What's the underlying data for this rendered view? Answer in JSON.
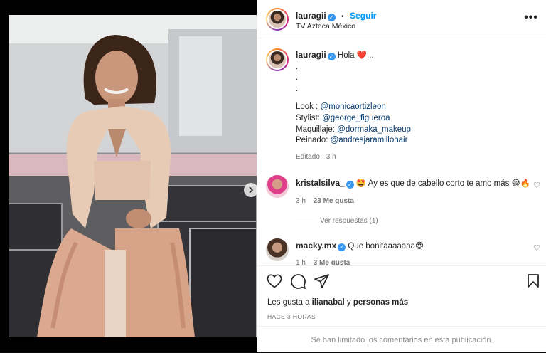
{
  "post": {
    "author": "lauragii",
    "follow_label": "Seguir",
    "separator": "•",
    "location": "TV Azteca México",
    "more_label": "•••"
  },
  "caption": {
    "username": "lauragii",
    "greeting": "Hola ❤️...",
    "dots": [
      ".",
      ".",
      "."
    ],
    "look_label": "Look :",
    "look_mention": "@monicaortizleon",
    "stylist_label": "Stylist:",
    "stylist_mention": "@george_figueroa",
    "makeup_label": "Maquillaje:",
    "makeup_mention": "@dormaka_makeup",
    "hair_label": "Peinado:",
    "hair_mention": "@andresjaramillohair",
    "edited": "Editado · 3 h"
  },
  "comments": [
    {
      "username": "kristalsilva_",
      "text": "🤩 Ay es que de cabello corto te amo más 😅🔥",
      "time": "3 h",
      "likes": "23 Me gusta",
      "replies": "Ver respuestas (1)"
    },
    {
      "username": "macky.mx",
      "text": "Que bonitaaaaaaa😍",
      "time": "1 h",
      "likes": "3 Me gusta"
    }
  ],
  "footer": {
    "likes_prefix": "Les gusta a",
    "likes_user": "ilianabal",
    "likes_and": "y",
    "likes_others": "personas más",
    "posted": "HACE 3 HORAS",
    "comments_limited": "Se han limitado los comentarios en esta publicación."
  },
  "carousel": {
    "total": 3,
    "current": 1
  },
  "colors": {
    "link": "#00376b",
    "follow": "#0095f6",
    "verified": "#3897f0",
    "muted": "#737373"
  }
}
